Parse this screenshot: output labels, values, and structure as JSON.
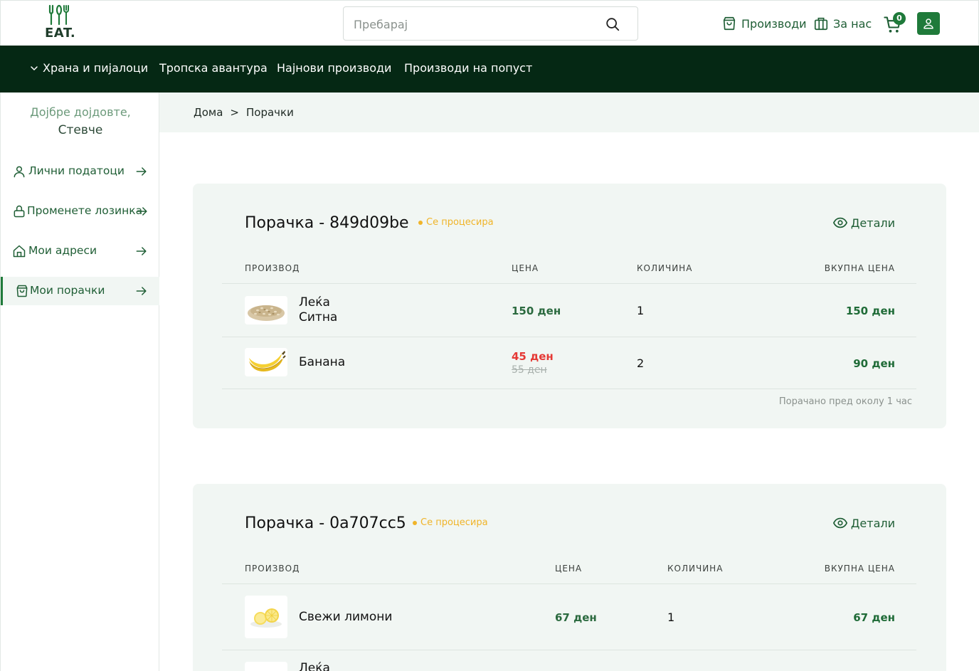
{
  "brand": {
    "logo_text": "EAT."
  },
  "header": {
    "search_placeholder": "Пребарај",
    "products_label": "Производи",
    "about_label": "За нас",
    "cart_count": "0"
  },
  "nav": {
    "items": [
      "Храна и пијалоци",
      "Тропска авантура",
      "Најнови производи",
      "Производи на попуст"
    ]
  },
  "sidebar": {
    "welcome": "Дојбре дојдовте,",
    "user_name": "Стевче",
    "items": [
      {
        "label": "Лични податоци",
        "icon": "user-icon"
      },
      {
        "label": "Променете лозинка",
        "icon": "lock-icon"
      },
      {
        "label": "Мои адреси",
        "icon": "home-icon"
      },
      {
        "label": "Мои порачки",
        "icon": "shopping-bag-icon",
        "active": true
      }
    ]
  },
  "breadcrumb": {
    "home": "Дома",
    "separator": ">",
    "current": "Порачки"
  },
  "table_headers": {
    "product": "ПРОИЗВОД",
    "price": "ЦЕНА",
    "quantity": "КОЛИЧИНА",
    "total": "ВКУПНА ЦЕНА"
  },
  "orders": [
    {
      "title": "Порачка - 849d09be",
      "status": "Се процесира",
      "details_label": "Детали",
      "items": [
        {
          "name": "Леќа\nСитна",
          "price": "150 ден",
          "quantity": "1",
          "total": "150 ден",
          "image": "lentils-image"
        },
        {
          "name": "Банана",
          "price": "45 ден",
          "old_price": "55 ден",
          "quantity": "2",
          "total": "90 ден",
          "image": "banana-image"
        }
      ],
      "ordered_at": "Порачано пред околу 1 час"
    },
    {
      "title": "Порачка - 0a707cc5",
      "status": "Се процесира",
      "details_label": "Детали",
      "items": [
        {
          "name": "Свежи лимони",
          "price": "67 ден",
          "quantity": "1",
          "total": "67 ден",
          "image": "lemon-image"
        },
        {
          "name": "Леќа",
          "image": "lentils-image"
        }
      ]
    }
  ],
  "colors": {
    "brand_green": "#1f7a3a",
    "nav_dark": "#052814",
    "status_yellow": "#f0b429",
    "sale_red": "#e53935",
    "panel_bg": "#f1f6f3"
  }
}
